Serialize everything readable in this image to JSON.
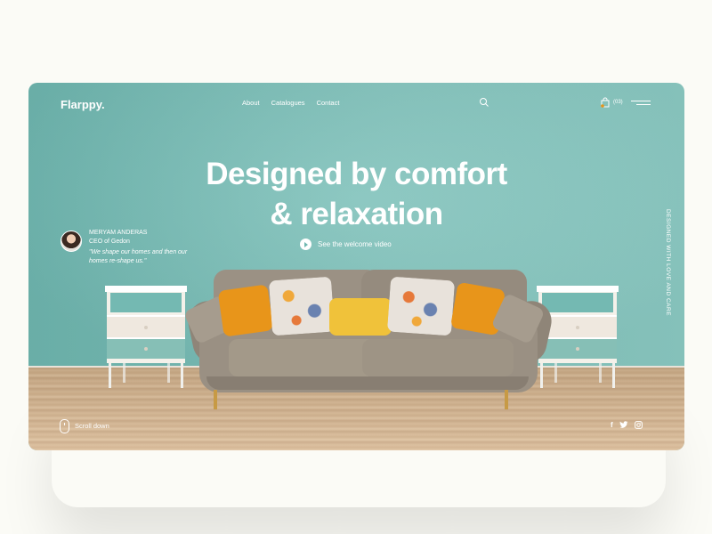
{
  "brand": {
    "logo": "Flarppy."
  },
  "nav": {
    "items": [
      "About",
      "Catalogues",
      "Contact"
    ]
  },
  "header": {
    "cart_count": "(03)"
  },
  "hero": {
    "headline_line1": "Designed by comfort",
    "headline_line2": "& relaxation",
    "video_label": "See the welcome video"
  },
  "testimonial": {
    "name": "MERYAM ANDERAS",
    "role": "CEO of Gedon",
    "quote": "\"We shape our homes and then our homes re-shape us.\""
  },
  "side_text": "DESIGNED WITH LOVE AND CARE",
  "scroll_label": "Scroll down",
  "social": [
    "f",
    "t",
    "ig"
  ],
  "colors": {
    "wall": "#7bbdb6",
    "sofa": "#9a9083",
    "pillow_orange": "#e8951a",
    "pillow_yellow": "#f0c23a",
    "floor": "#d3b38e"
  },
  "icons": [
    "search-icon",
    "bag-icon",
    "menu-icon",
    "play-icon",
    "mouse-icon",
    "facebook-icon",
    "twitter-icon",
    "instagram-icon"
  ]
}
